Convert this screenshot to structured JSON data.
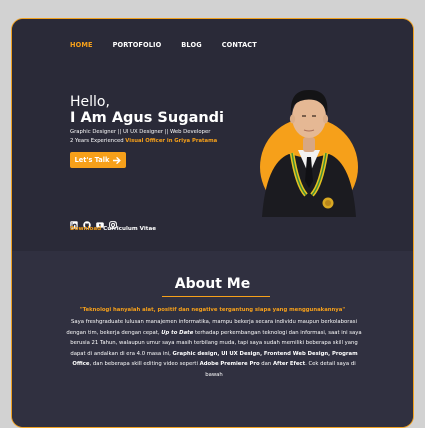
{
  "nav": {
    "items": [
      {
        "label": "HOME",
        "active": true
      },
      {
        "label": "PORTOFOLIO",
        "active": false
      },
      {
        "label": "BLOG",
        "active": false
      },
      {
        "label": "CONTACT",
        "active": false
      }
    ]
  },
  "hero": {
    "greeting": "Hello,",
    "name": "I Am Agus Sugandi",
    "roles": "Graphic Designer || UI UX Designer || Web Developer",
    "experience_prefix": "2 Years Experienced ",
    "experience_highlight": "Visual Officer in Griya Pratama",
    "cta_label": "Let's Talk",
    "download_prefix": "Download",
    "download_suffix": " Curriculum Vitae",
    "social_icons": [
      "linkedin-icon",
      "github-icon",
      "youtube-icon",
      "instagram-icon"
    ]
  },
  "about": {
    "title": "About Me",
    "quote": "\"Teknologi hanyalah alat, positif dan negative tergantung siapa yang menggunakannya\"",
    "p1": "Saya freshgraduate lulusan manajemen informatika, mampu bekerja secara individu maupun berkolaborasi dengan tim, bekerja dengan cepat, ",
    "p1_bold_italic": "Up to Date",
    "p2": " terhadap perkembangan teknologi dan informasi, saat ini saya berusia 21 Tahun, walaupun umur saya masih terbilang muda, tapi saya sudah memiliki beberapa skill yang dapat di andalkan di era 4.0 masa ini, ",
    "skills_bold": "Graphic design, UI UX Design, Frontend Web Design, Program Office",
    "p3": ", dan beberapa skill editing video seperti ",
    "tool1_bold": "Adobe Premiere Pro",
    "p4": " dan ",
    "tool2_bold": "After Efect",
    "p5": ". Cek detail saya di bawah"
  },
  "colors": {
    "accent": "#f6a01a",
    "hero_bg": "#2a2a38",
    "about_bg": "#303040"
  }
}
